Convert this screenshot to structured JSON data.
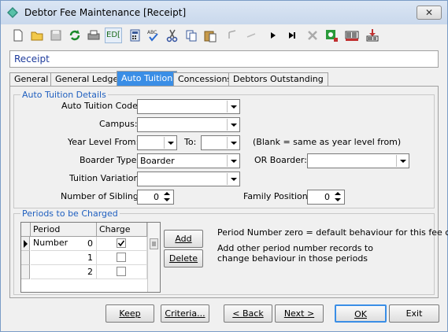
{
  "window": {
    "title": "Debtor Fee Maintenance  [Receipt]",
    "close_label": "✕"
  },
  "toolbar": {
    "items": [
      "new-doc",
      "open-folder",
      "save",
      "refresh",
      "print",
      "edit",
      "calculator",
      "spell-check",
      "cut",
      "copy",
      "paste",
      "undo",
      "redo",
      "next-record",
      "last-record",
      "delete",
      "find",
      "barcode",
      "export"
    ],
    "edit_label": "ED["
  },
  "header": {
    "title": "Receipt"
  },
  "tabs": [
    {
      "label": "General"
    },
    {
      "label": "General Ledger"
    },
    {
      "label": "Auto Tuition",
      "active": true
    },
    {
      "label": "Concessions"
    },
    {
      "label": "Debtors Outstanding"
    }
  ],
  "auto_tuition": {
    "legend": "Auto Tuition Details",
    "code_label": "Auto Tuition Code:",
    "code_value": "",
    "campus_label": "Campus:",
    "campus_value": "",
    "year_from_label": "Year Level From:",
    "year_from_value": "",
    "to_label": "To:",
    "to_value": "",
    "year_note": "(Blank = same as year level from)",
    "boarder_type_label": "Boarder Type:",
    "boarder_type_value": "Boarder",
    "or_boarder_label": "OR Boarder:",
    "or_boarder_value": "",
    "variation_label": "Tuition Variation:",
    "variation_value": "",
    "siblings_label": "Number of Siblings:",
    "siblings_value": "0",
    "family_label": "Family Position:",
    "family_value": "0"
  },
  "periods": {
    "legend": "Periods to be Charged",
    "columns": [
      "Period Number",
      "Charge"
    ],
    "rows": [
      {
        "period": "0",
        "charge": true
      },
      {
        "period": "1",
        "charge": false
      },
      {
        "period": "2",
        "charge": false
      }
    ],
    "add_label": "Add",
    "delete_label": "Delete",
    "info1": "Period Number zero = default behaviour for this fee code",
    "info2": "Add other period number records to change behaviour in those periods"
  },
  "footer": {
    "keep": "Keep",
    "criteria": "Criteria...",
    "back": "< Back",
    "next": "Next >",
    "ok": "OK",
    "exit": "Exit"
  },
  "colors": {
    "accent": "#3a8ee6",
    "legend": "#1f5fbf",
    "header_text": "#1f3c9c"
  }
}
